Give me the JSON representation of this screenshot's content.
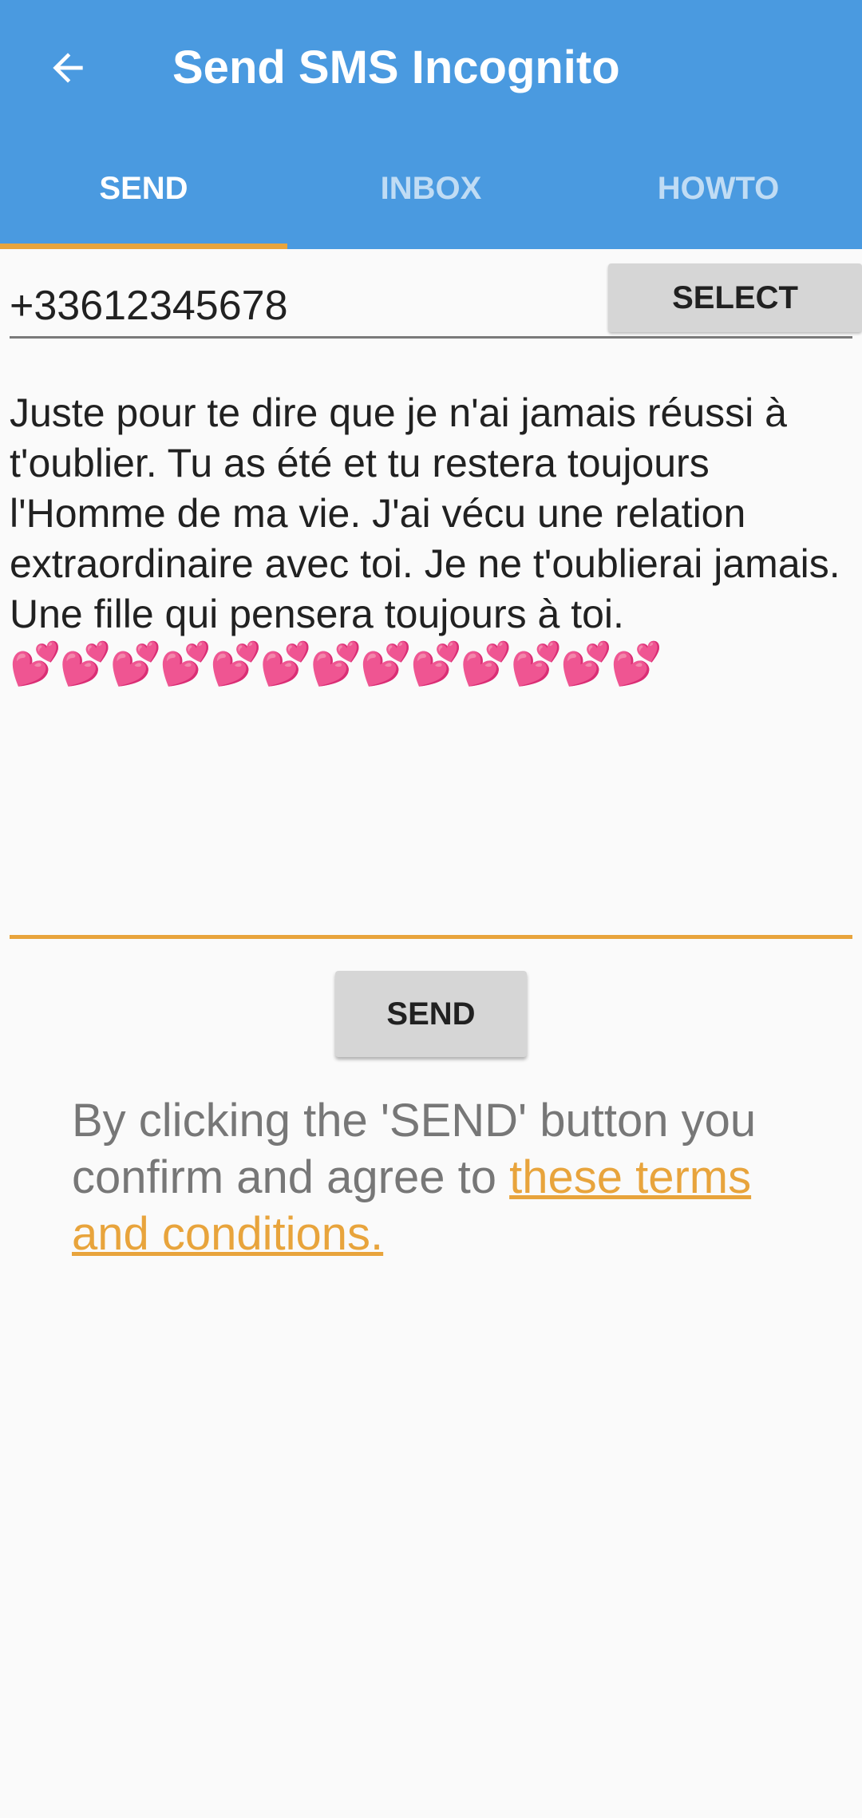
{
  "app": {
    "title": "Send SMS Incognito",
    "accent_color": "#4a9ae0",
    "highlight_color": "#e8a43c"
  },
  "toolbar": {
    "back_icon": "arrow-left-icon"
  },
  "tabs": [
    {
      "label": "SEND",
      "active": true
    },
    {
      "label": "INBOX",
      "active": false
    },
    {
      "label": "HOWTO",
      "active": false
    }
  ],
  "form": {
    "phone_value": "+33612345678",
    "select_label": "SELECT",
    "message_text": "Juste pour te dire que je n'ai jamais réussi à t'oublier. Tu as été et tu restera toujours l'Homme de ma vie. J'ai vécu une relation extraordinaire avec toi. Je ne t'oublierai jamais.\nUne fille qui pensera toujours à toi.\n",
    "message_hearts": "💕💕💕💕💕💕💕💕💕💕💕💕💕",
    "send_label": "SEND"
  },
  "terms": {
    "prefix": "By clicking the 'SEND' button you confirm and agree to ",
    "link_text": "these terms and conditions."
  }
}
